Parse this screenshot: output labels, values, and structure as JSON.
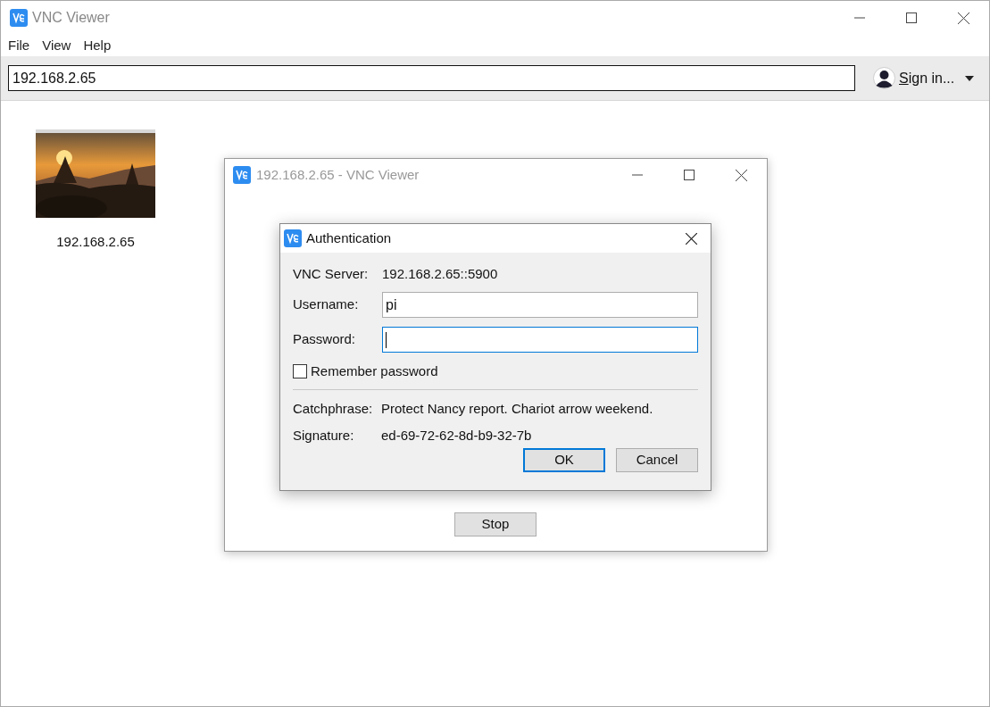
{
  "window": {
    "title": "VNC Viewer"
  },
  "menu": [
    "File",
    "View",
    "Help"
  ],
  "address_bar": {
    "value": "192.168.2.65"
  },
  "account": {
    "label": "Sign in..."
  },
  "connections": [
    {
      "label": "192.168.2.65",
      "kind": "picture"
    }
  ],
  "connection_window": {
    "title": "192.168.2.65 - VNC Viewer",
    "stop_button": "Stop"
  },
  "auth_dialog": {
    "title": "Authentication",
    "server_label": "VNC Server:",
    "server_value": "192.168.2.65::5900",
    "fields": [
      {
        "label": "Username:",
        "value": "pi",
        "focused": false
      },
      {
        "label": "Password:",
        "focused": true
      }
    ],
    "remember": {
      "label": "Remember password",
      "checked": false
    },
    "catchphrase_label": "Catchphrase:",
    "catchphrase_value": "Protect Nancy report. Chariot arrow weekend.",
    "signature_label": "Signature:",
    "signature_value": "ed-69-72-62-8d-b9-32-7b",
    "buttons": [
      {
        "label": "OK",
        "default": true
      },
      {
        "label": "Cancel",
        "default": false
      }
    ]
  }
}
